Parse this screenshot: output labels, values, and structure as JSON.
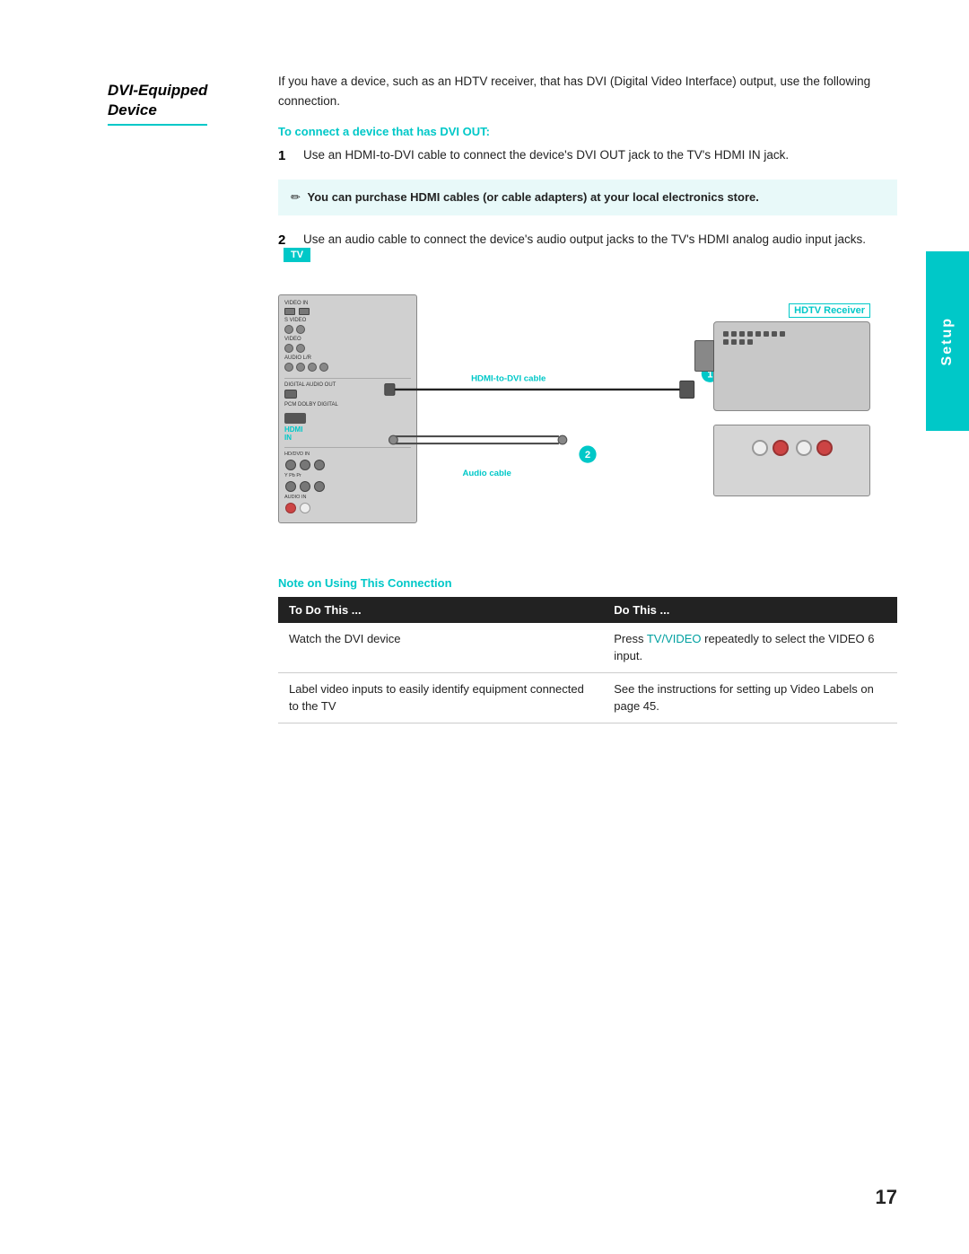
{
  "side_tab": {
    "text": "Setup"
  },
  "page_number": "17",
  "section": {
    "title_line1": "DVI-Equipped",
    "title_line2": "Device",
    "intro": "If you have a device, such as an HDTV receiver, that has DVI (Digital Video Interface) output, use the following connection.",
    "sub_heading": "To connect a device that has DVI OUT:",
    "step1": "Use an HDMI-to-DVI cable to connect the device's DVI OUT jack to the TV's HDMI IN jack.",
    "step2": "Use an audio cable to connect the device's audio output jacks to the TV's HDMI analog audio input jacks.",
    "note_text": "You can purchase HDMI cables (or cable adapters) at your local electronics store.",
    "diagram_labels": {
      "tv": "TV",
      "hdmi_cable": "HDMI-to-DVI cable",
      "audio_cable": "Audio cable",
      "hdtv_receiver": "HDTV Receiver"
    }
  },
  "note_section": {
    "title": "Note on Using This Connection",
    "table": {
      "col1_header": "To Do This ...",
      "col2_header": "Do This ...",
      "rows": [
        {
          "col1": "Watch the DVI device",
          "col2_prefix": "Press ",
          "col2_link": "TV/VIDEO",
          "col2_suffix": " repeatedly to select the VIDEO 6 input."
        },
        {
          "col1": "Label video inputs to easily identify equipment connected to the TV",
          "col2": "See the instructions for setting up Video Labels on page 45."
        }
      ]
    }
  }
}
